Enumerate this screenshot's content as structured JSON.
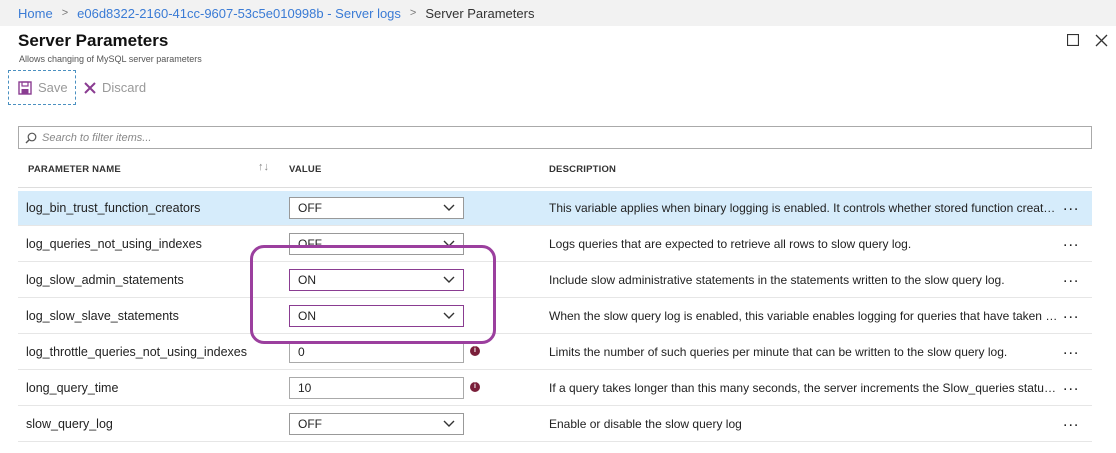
{
  "breadcrumb": {
    "home": "Home",
    "resource": "e06d8322-2160-41cc-9607-53c5e010998b - Server logs",
    "current": "Server Parameters"
  },
  "header": {
    "title": "Server Parameters",
    "subtitle": "Allows changing of MySQL server parameters"
  },
  "toolbar": {
    "save_label": "Save",
    "discard_label": "Discard"
  },
  "filter": {
    "placeholder": "Search to filter items..."
  },
  "table": {
    "headers": {
      "name": "PARAMETER NAME",
      "value": "VALUE",
      "description": "DESCRIPTION"
    },
    "rows": [
      {
        "name": "log_bin_trust_function_creators",
        "value": "OFF",
        "control": "select",
        "description": "This variable applies when binary logging is enabled. It controls whether stored function creato..."
      },
      {
        "name": "log_queries_not_using_indexes",
        "value": "OFF",
        "control": "select",
        "description": "Logs queries that are expected to retrieve all rows to slow query log."
      },
      {
        "name": "log_slow_admin_statements",
        "value": "ON",
        "control": "select",
        "description": "Include slow administrative statements in the statements written to the slow query log."
      },
      {
        "name": "log_slow_slave_statements",
        "value": "ON",
        "control": "select",
        "description": "When the slow query log is enabled, this variable enables logging for queries that have taken m..."
      },
      {
        "name": "log_throttle_queries_not_using_indexes",
        "value": "0",
        "control": "text",
        "description": "Limits the number of such queries per minute that can be written to the slow query log."
      },
      {
        "name": "long_query_time",
        "value": "10",
        "control": "text",
        "description": "If a query takes longer than this many seconds, the server increments the Slow_queries status v..."
      },
      {
        "name": "slow_query_log",
        "value": "OFF",
        "control": "select",
        "description": "Enable or disable the slow query log"
      }
    ],
    "more_label": "..."
  },
  "colors": {
    "link": "#3a7bd5",
    "selected_row": "#d6ecfb",
    "highlight": "#9b3f9e",
    "info": "#7a1f3a"
  }
}
